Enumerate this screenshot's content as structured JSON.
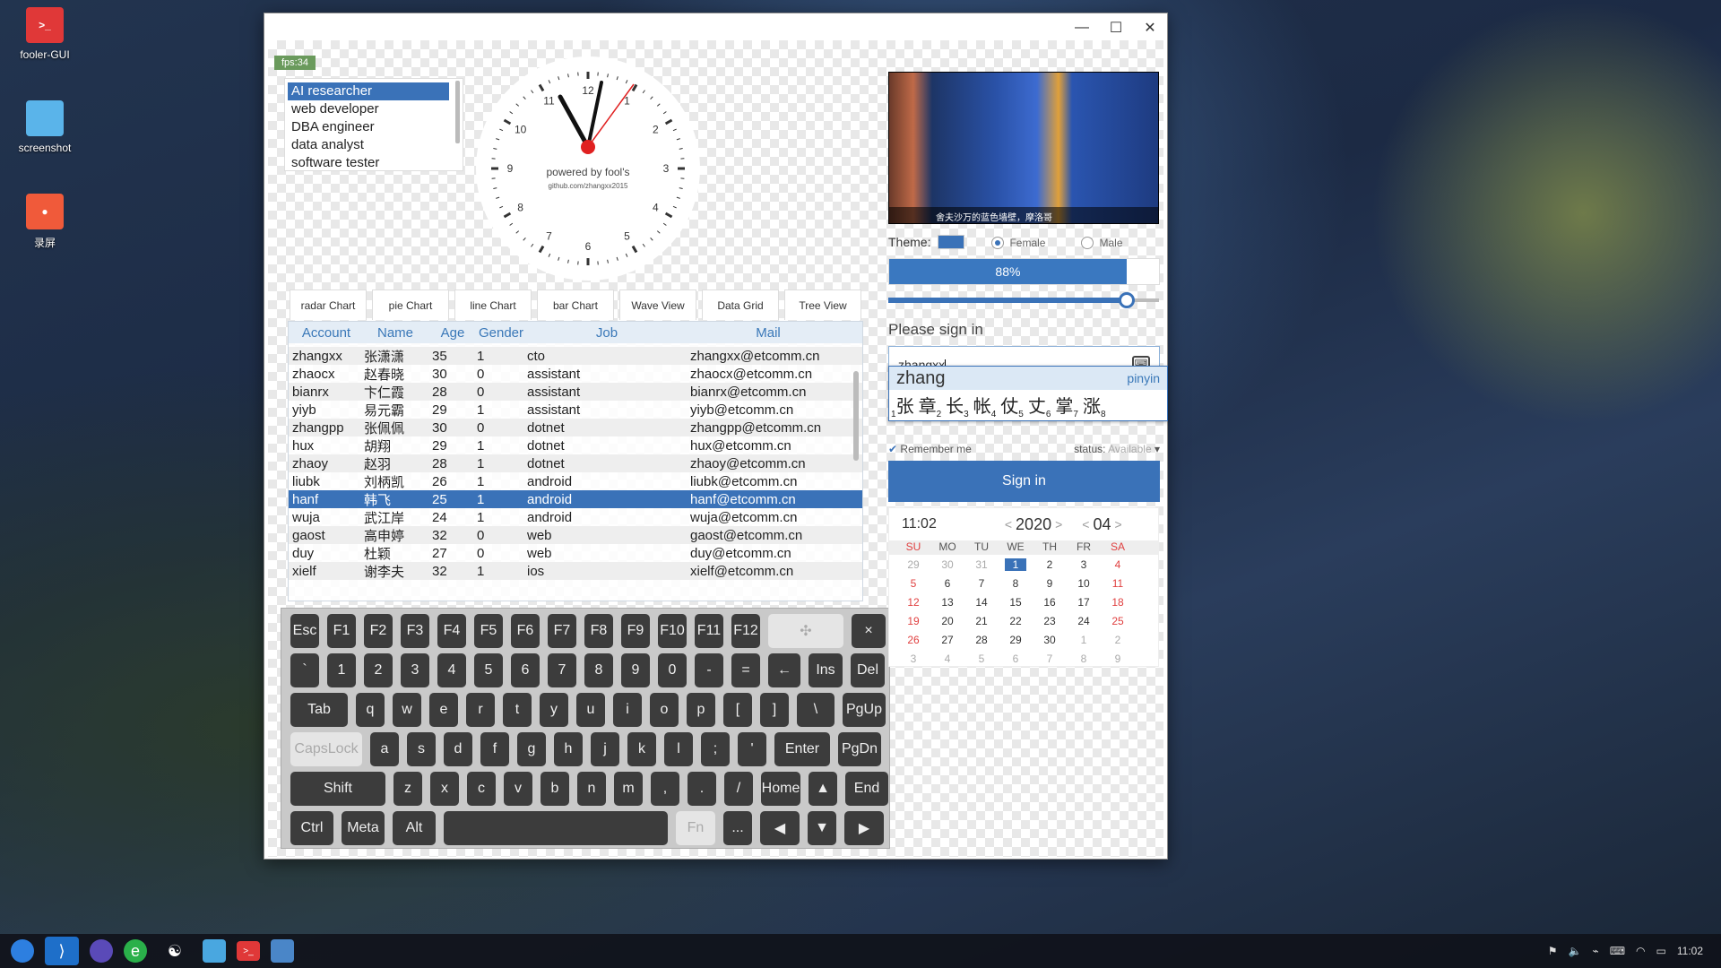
{
  "desktop": {
    "icons": [
      {
        "label": "fooler-GUI"
      },
      {
        "label": "screenshot"
      },
      {
        "label": "录屏"
      }
    ]
  },
  "window": {
    "controls": {
      "minimize": "—",
      "maximize": "☐",
      "close": "✕"
    }
  },
  "fps": "fps:34",
  "jobs": [
    "AI researcher",
    "web developer",
    "DBA engineer",
    "data analyst",
    "software tester"
  ],
  "clock": {
    "brand": "powered by fool's",
    "url": "github.com/zhangxx2015",
    "numbers": [
      "12",
      "1",
      "2",
      "3",
      "4",
      "5",
      "6",
      "7",
      "8",
      "9",
      "10",
      "11"
    ]
  },
  "tabs": [
    "radar Chart",
    "pie Chart",
    "line Chart",
    "bar Chart",
    "Wave View",
    "Data Grid",
    "Tree View"
  ],
  "grid": {
    "columns": [
      "Account",
      "Name",
      "Age",
      "Gender",
      "Job",
      "Mail"
    ],
    "rows": [
      [
        "zhangxx",
        "张潇潇",
        "35",
        "1",
        "cto",
        "zhangxx@etcomm.cn"
      ],
      [
        "zhaocx",
        "赵春晓",
        "30",
        "0",
        "assistant",
        "zhaocx@etcomm.cn"
      ],
      [
        "bianrx",
        "卞仁霞",
        "28",
        "0",
        "assistant",
        "bianrx@etcomm.cn"
      ],
      [
        "yiyb",
        "易元霸",
        "29",
        "1",
        "assistant",
        "yiyb@etcomm.cn"
      ],
      [
        "zhangpp",
        "张佩佩",
        "30",
        "0",
        "dotnet",
        "zhangpp@etcomm.cn"
      ],
      [
        "hux",
        "胡翔",
        "29",
        "1",
        "dotnet",
        "hux@etcomm.cn"
      ],
      [
        "zhaoy",
        "赵羽",
        "28",
        "1",
        "dotnet",
        "zhaoy@etcomm.cn"
      ],
      [
        "liubk",
        "刘柄凯",
        "26",
        "1",
        "android",
        "liubk@etcomm.cn"
      ],
      [
        "hanf",
        "韩飞",
        "25",
        "1",
        "android",
        "hanf@etcomm.cn"
      ],
      [
        "wuja",
        "武江岸",
        "24",
        "1",
        "android",
        "wuja@etcomm.cn"
      ],
      [
        "gaost",
        "高申婷",
        "32",
        "0",
        "web",
        "gaost@etcomm.cn"
      ],
      [
        "duy",
        "杜颖",
        "27",
        "0",
        "web",
        "duy@etcomm.cn"
      ],
      [
        "xielf",
        "谢李夫",
        "32",
        "1",
        "ios",
        "xielf@etcomm.cn"
      ]
    ],
    "selected_index": 8
  },
  "keyboard": {
    "rows": [
      [
        "Esc",
        "F1",
        "F2",
        "F3",
        "F4",
        "F5",
        "F6",
        "F7",
        "F8",
        "F9",
        "F10",
        "F11",
        "F12",
        "✣",
        "×"
      ],
      [
        "`",
        "1",
        "2",
        "3",
        "4",
        "5",
        "6",
        "7",
        "8",
        "9",
        "0",
        "-",
        "=",
        "←",
        "Ins",
        "Del"
      ],
      [
        "Tab",
        "q",
        "w",
        "e",
        "r",
        "t",
        "y",
        "u",
        "i",
        "o",
        "p",
        "[",
        "]",
        "\\",
        "PgUp"
      ],
      [
        "CapsLock",
        "a",
        "s",
        "d",
        "f",
        "g",
        "h",
        "j",
        "k",
        "l",
        ";",
        "'",
        "Enter",
        "PgDn"
      ],
      [
        "Shift",
        "z",
        "x",
        "c",
        "v",
        "b",
        "n",
        "m",
        ",",
        ".",
        "/",
        "Home",
        "▲",
        "End"
      ],
      [
        "Ctrl",
        "Meta",
        "Alt",
        " ",
        "Fn",
        "...",
        "◀",
        "▼",
        "▶"
      ]
    ]
  },
  "right": {
    "photo_caption": "舍夫沙万的蓝色墙壁，摩洛哥",
    "theme_label": "Theme:",
    "theme_color": "#3a72b8",
    "gender": {
      "female": "Female",
      "male": "Male",
      "selected": "Female"
    },
    "progress": {
      "text": "88%",
      "value": 88
    },
    "slider_value": 0.88,
    "sign_title": "Please sign in",
    "username": "zhangxx",
    "ime": {
      "composition": "zhang",
      "mode": "pinyin",
      "candidates": [
        "张",
        "章",
        "长",
        "帐",
        "仗",
        "丈",
        "掌",
        "涨"
      ]
    },
    "remember": "Remember me",
    "status_label": "status:",
    "status_value": "Available",
    "signin": "Sign in",
    "calendar": {
      "time": "11:02",
      "year": "2020",
      "month": "04",
      "dow": [
        "SU",
        "MO",
        "TU",
        "WE",
        "TH",
        "FR",
        "SA"
      ],
      "weeks": [
        [
          "29",
          "30",
          "31",
          "1",
          "2",
          "3",
          "4"
        ],
        [
          "5",
          "6",
          "7",
          "8",
          "9",
          "10",
          "11"
        ],
        [
          "12",
          "13",
          "14",
          "15",
          "16",
          "17",
          "18"
        ],
        [
          "19",
          "20",
          "21",
          "22",
          "23",
          "24",
          "25"
        ],
        [
          "26",
          "27",
          "28",
          "29",
          "30",
          "1",
          "2"
        ],
        [
          "3",
          "4",
          "5",
          "6",
          "7",
          "8",
          "9"
        ]
      ],
      "today": "1"
    }
  },
  "taskbar": {
    "clock": "11:02"
  }
}
